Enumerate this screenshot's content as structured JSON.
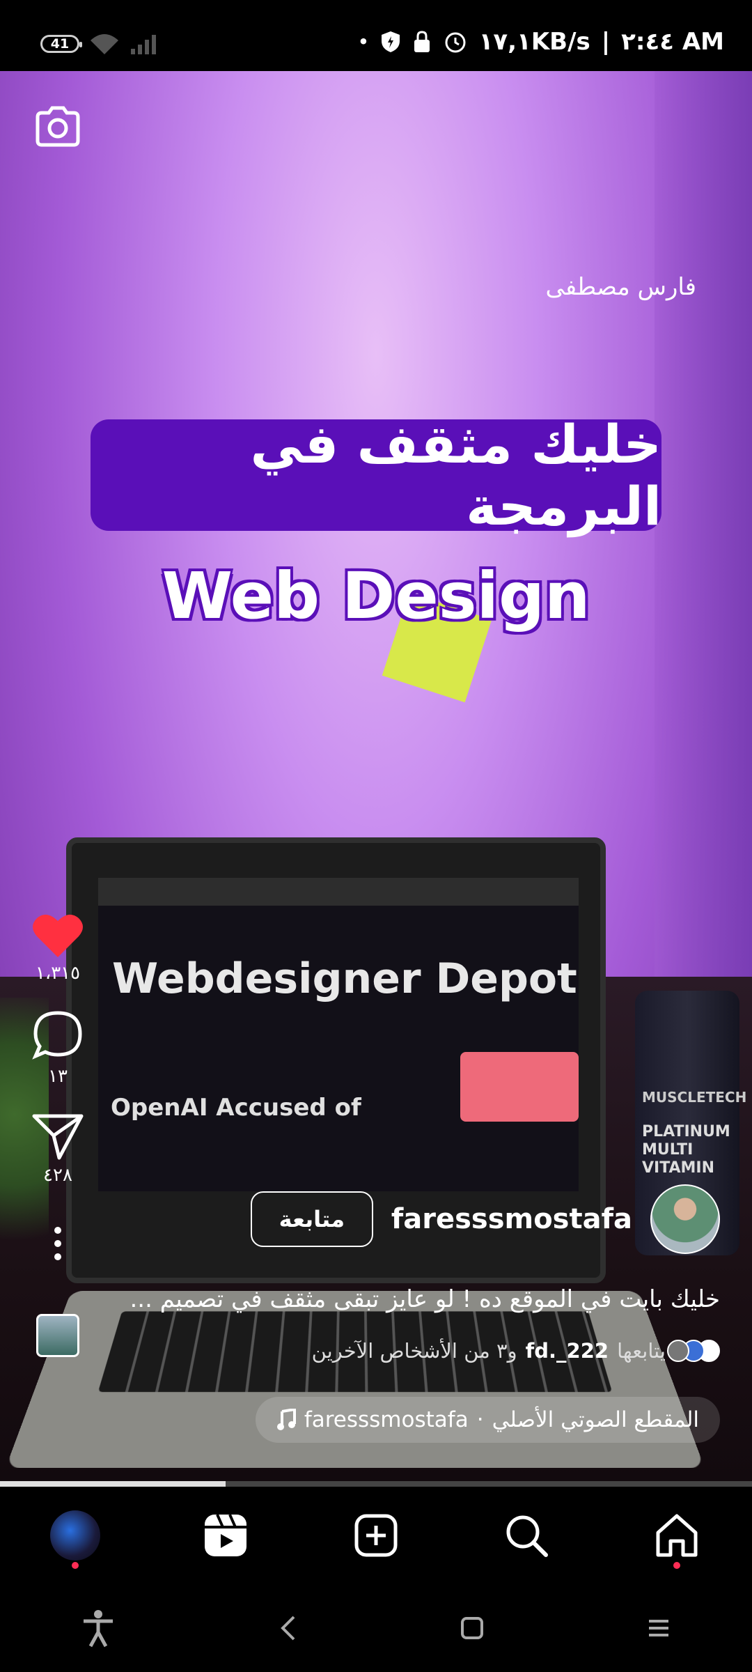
{
  "status_bar": {
    "battery": "41",
    "network_speed": "١٧,١KB/s",
    "time": "٢:٤٤ AM"
  },
  "overlay": {
    "creator_watermark": "فارس مصطفى",
    "title": "خليك مثقف في البرمجة",
    "subtitle": "Web Design"
  },
  "video_scene": {
    "laptop_hero": "Webdesigner Depot",
    "laptop_headline": "OpenAI Accused of",
    "bottle_brand": "MUSCLETECH",
    "bottle_label": "PLATINUM MULTI VITAMIN"
  },
  "side_actions": {
    "likes": "١،٣١٥",
    "comments": "١٣",
    "shares": "٤٢٨"
  },
  "author": {
    "username": "faresssmostafa",
    "follow_label": "متابعة"
  },
  "caption": "خليك بايت في الموقع ده ! لو عايز تبقى مثقف في تصميم ...",
  "followed_by": {
    "prefix": "يتابعها",
    "account": "fd._222",
    "suffix": "و٣ من الأشخاص الآخرين"
  },
  "audio": {
    "label": "المقطع الصوتي الأصلي",
    "separator": "·",
    "artist": "faresssmostafa"
  },
  "playback_progress": 0.3,
  "colors": {
    "like_red": "#ff3040",
    "overlay_purple": "#5a0fb8",
    "notification_dot": "#ff2d55"
  },
  "icons": {
    "tabs": [
      "profile-icon",
      "reels-icon",
      "create-icon",
      "search-icon",
      "home-icon"
    ],
    "nav": [
      "accessibility-icon",
      "back-icon",
      "home-circle-icon",
      "recents-icon"
    ]
  }
}
